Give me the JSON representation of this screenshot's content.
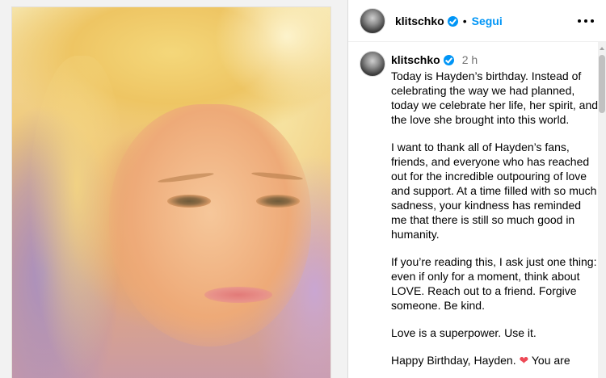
{
  "post": {
    "author": "klitschko",
    "follow_label": "Segui",
    "separator": "•",
    "time": "2 h"
  },
  "caption": {
    "p1": "Today is Hayden’s birthday. Instead of celebrating the way we had planned, today we celebrate her life, her spirit, and the love she brought into this world.",
    "p2": "I want to thank all of Hayden’s fans, friends, and everyone who has reached out for the incredible outpouring of love and support. At a time filled with so much sadness, your kindness has reminded me that there is still so much good in humanity.",
    "p3": "If you’re reading this, I ask just one thing: even if only for a moment, think about LOVE. Reach out to a friend. Forgive someone. Be kind.",
    "p4": "Love is a superpower. Use it.",
    "p5_before": "Happy Birthday, Hayden.",
    "p5_heart": "❤",
    "p5_after": "You are"
  },
  "icons": {
    "verified": "verified-badge-icon",
    "more": "more-options-icon",
    "heart": "red-heart-emoji"
  },
  "colors": {
    "accent": "#0095f6",
    "heart": "#ed4956",
    "muted": "#737373"
  }
}
